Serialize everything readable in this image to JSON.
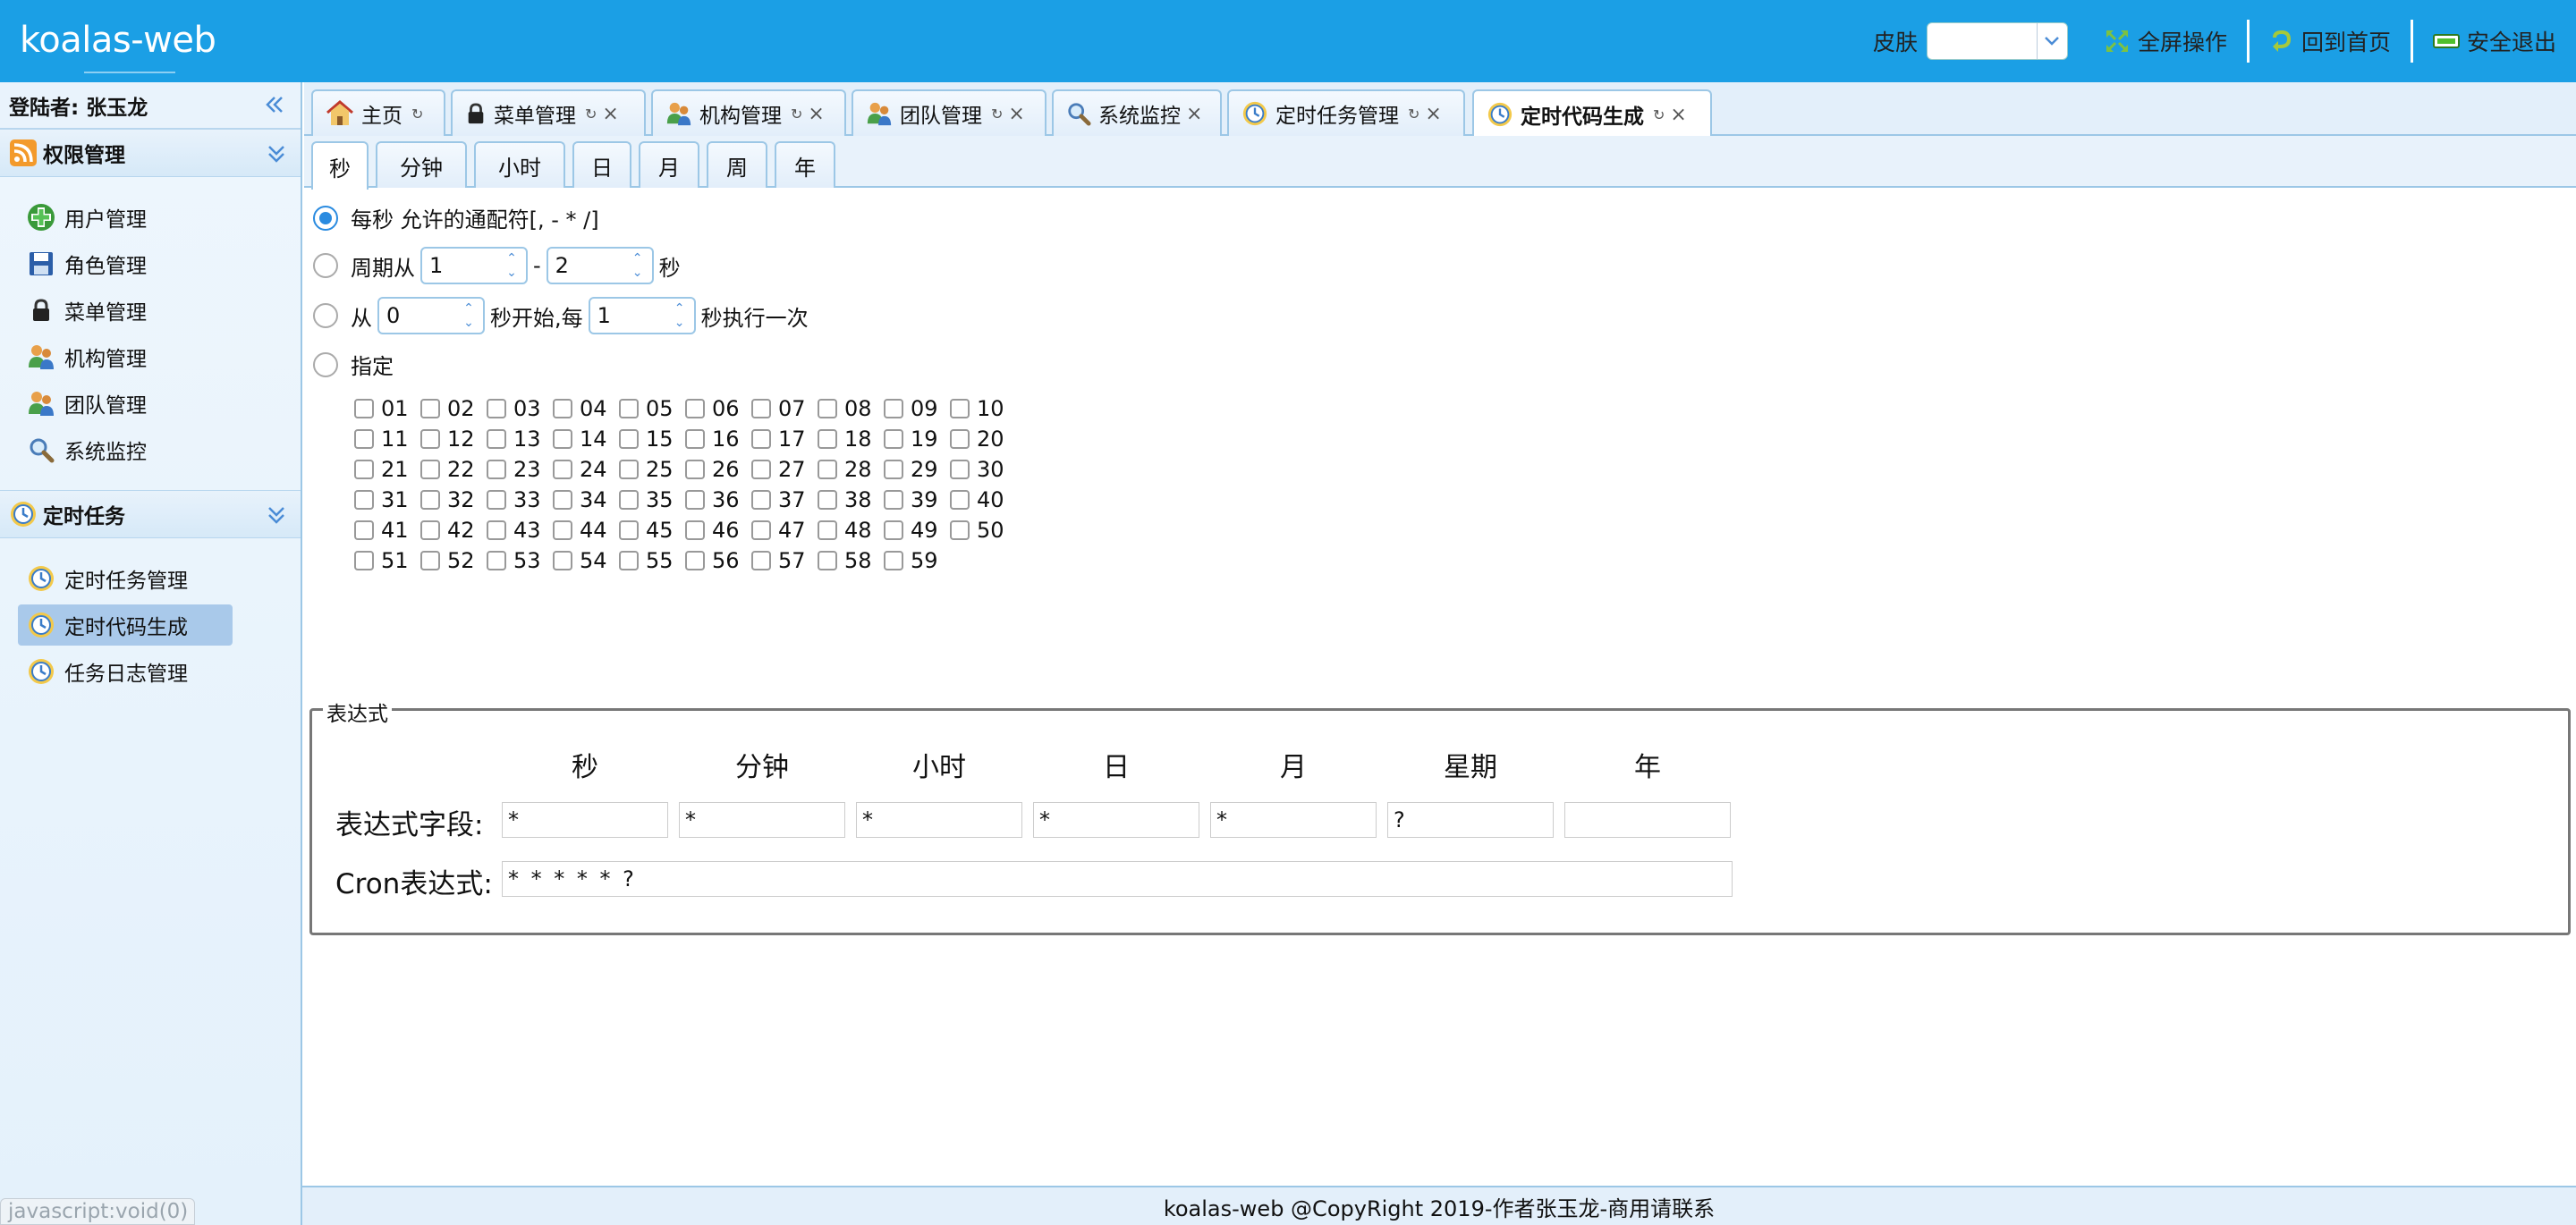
{
  "app": {
    "logo": "koalas-web"
  },
  "header": {
    "skin_label": "皮肤",
    "skin_value": "",
    "fullscreen_label": "全屏操作",
    "home_label": "回到首页",
    "logout_label": "安全退出"
  },
  "sidebar": {
    "login_user": "登陆者: 张玉龙",
    "groups": [
      {
        "title": "权限管理",
        "items": [
          "用户管理",
          "角色管理",
          "菜单管理",
          "机构管理",
          "团队管理",
          "系统监控"
        ]
      },
      {
        "title": "定时任务",
        "items": [
          "定时任务管理",
          "定时代码生成",
          "任务日志管理"
        ]
      }
    ],
    "active_item": "定时代码生成"
  },
  "tabs": [
    {
      "label": "主页",
      "closable": false
    },
    {
      "label": "菜单管理",
      "closable": true
    },
    {
      "label": "机构管理",
      "closable": true
    },
    {
      "label": "团队管理",
      "closable": true
    },
    {
      "label": "系统监控",
      "closable": true
    },
    {
      "label": "定时任务管理",
      "closable": true
    },
    {
      "label": "定时代码生成",
      "closable": true,
      "active": true
    }
  ],
  "subtabs": [
    "秒",
    "分钟",
    "小时",
    "日",
    "月",
    "周",
    "年"
  ],
  "active_subtab": "秒",
  "options": {
    "every": {
      "label": "每秒 允许的通配符[, - * /]",
      "checked": true
    },
    "period": {
      "prefix": "周期从",
      "from": "1",
      "dash": "-",
      "to": "2",
      "suffix": "秒"
    },
    "start": {
      "prefix": "从",
      "start": "0",
      "middle": "秒开始,每",
      "step": "1",
      "suffix": "秒执行一次"
    },
    "specify": {
      "label": "指定"
    }
  },
  "checkbox_rows": [
    [
      "01",
      "02",
      "03",
      "04",
      "05",
      "06",
      "07",
      "08",
      "09",
      "10"
    ],
    [
      "11",
      "12",
      "13",
      "14",
      "15",
      "16",
      "17",
      "18",
      "19",
      "20"
    ],
    [
      "21",
      "22",
      "23",
      "24",
      "25",
      "26",
      "27",
      "28",
      "29",
      "30"
    ],
    [
      "31",
      "32",
      "33",
      "34",
      "35",
      "36",
      "37",
      "38",
      "39",
      "40"
    ],
    [
      "41",
      "42",
      "43",
      "44",
      "45",
      "46",
      "47",
      "48",
      "49",
      "50"
    ],
    [
      "51",
      "52",
      "53",
      "54",
      "55",
      "56",
      "57",
      "58",
      "59"
    ]
  ],
  "expression": {
    "legend": "表达式",
    "headers": [
      "秒",
      "分钟",
      "小时",
      "日",
      "月",
      "星期",
      "年"
    ],
    "field_label": "表达式字段:",
    "fields": [
      "*",
      "*",
      "*",
      "*",
      "*",
      "?",
      ""
    ],
    "cron_label": "Cron表达式:",
    "cron_value": "* * * * * ?"
  },
  "footer": {
    "text": "koalas-web @CopyRight 2019-作者张玉龙-商用请联系"
  },
  "statusbar": {
    "text": "javascript:void(0)"
  },
  "colors": {
    "header_bg": "#1b9fe5",
    "accent": "#2a8be0",
    "active_menu": "#a9c9ea"
  }
}
